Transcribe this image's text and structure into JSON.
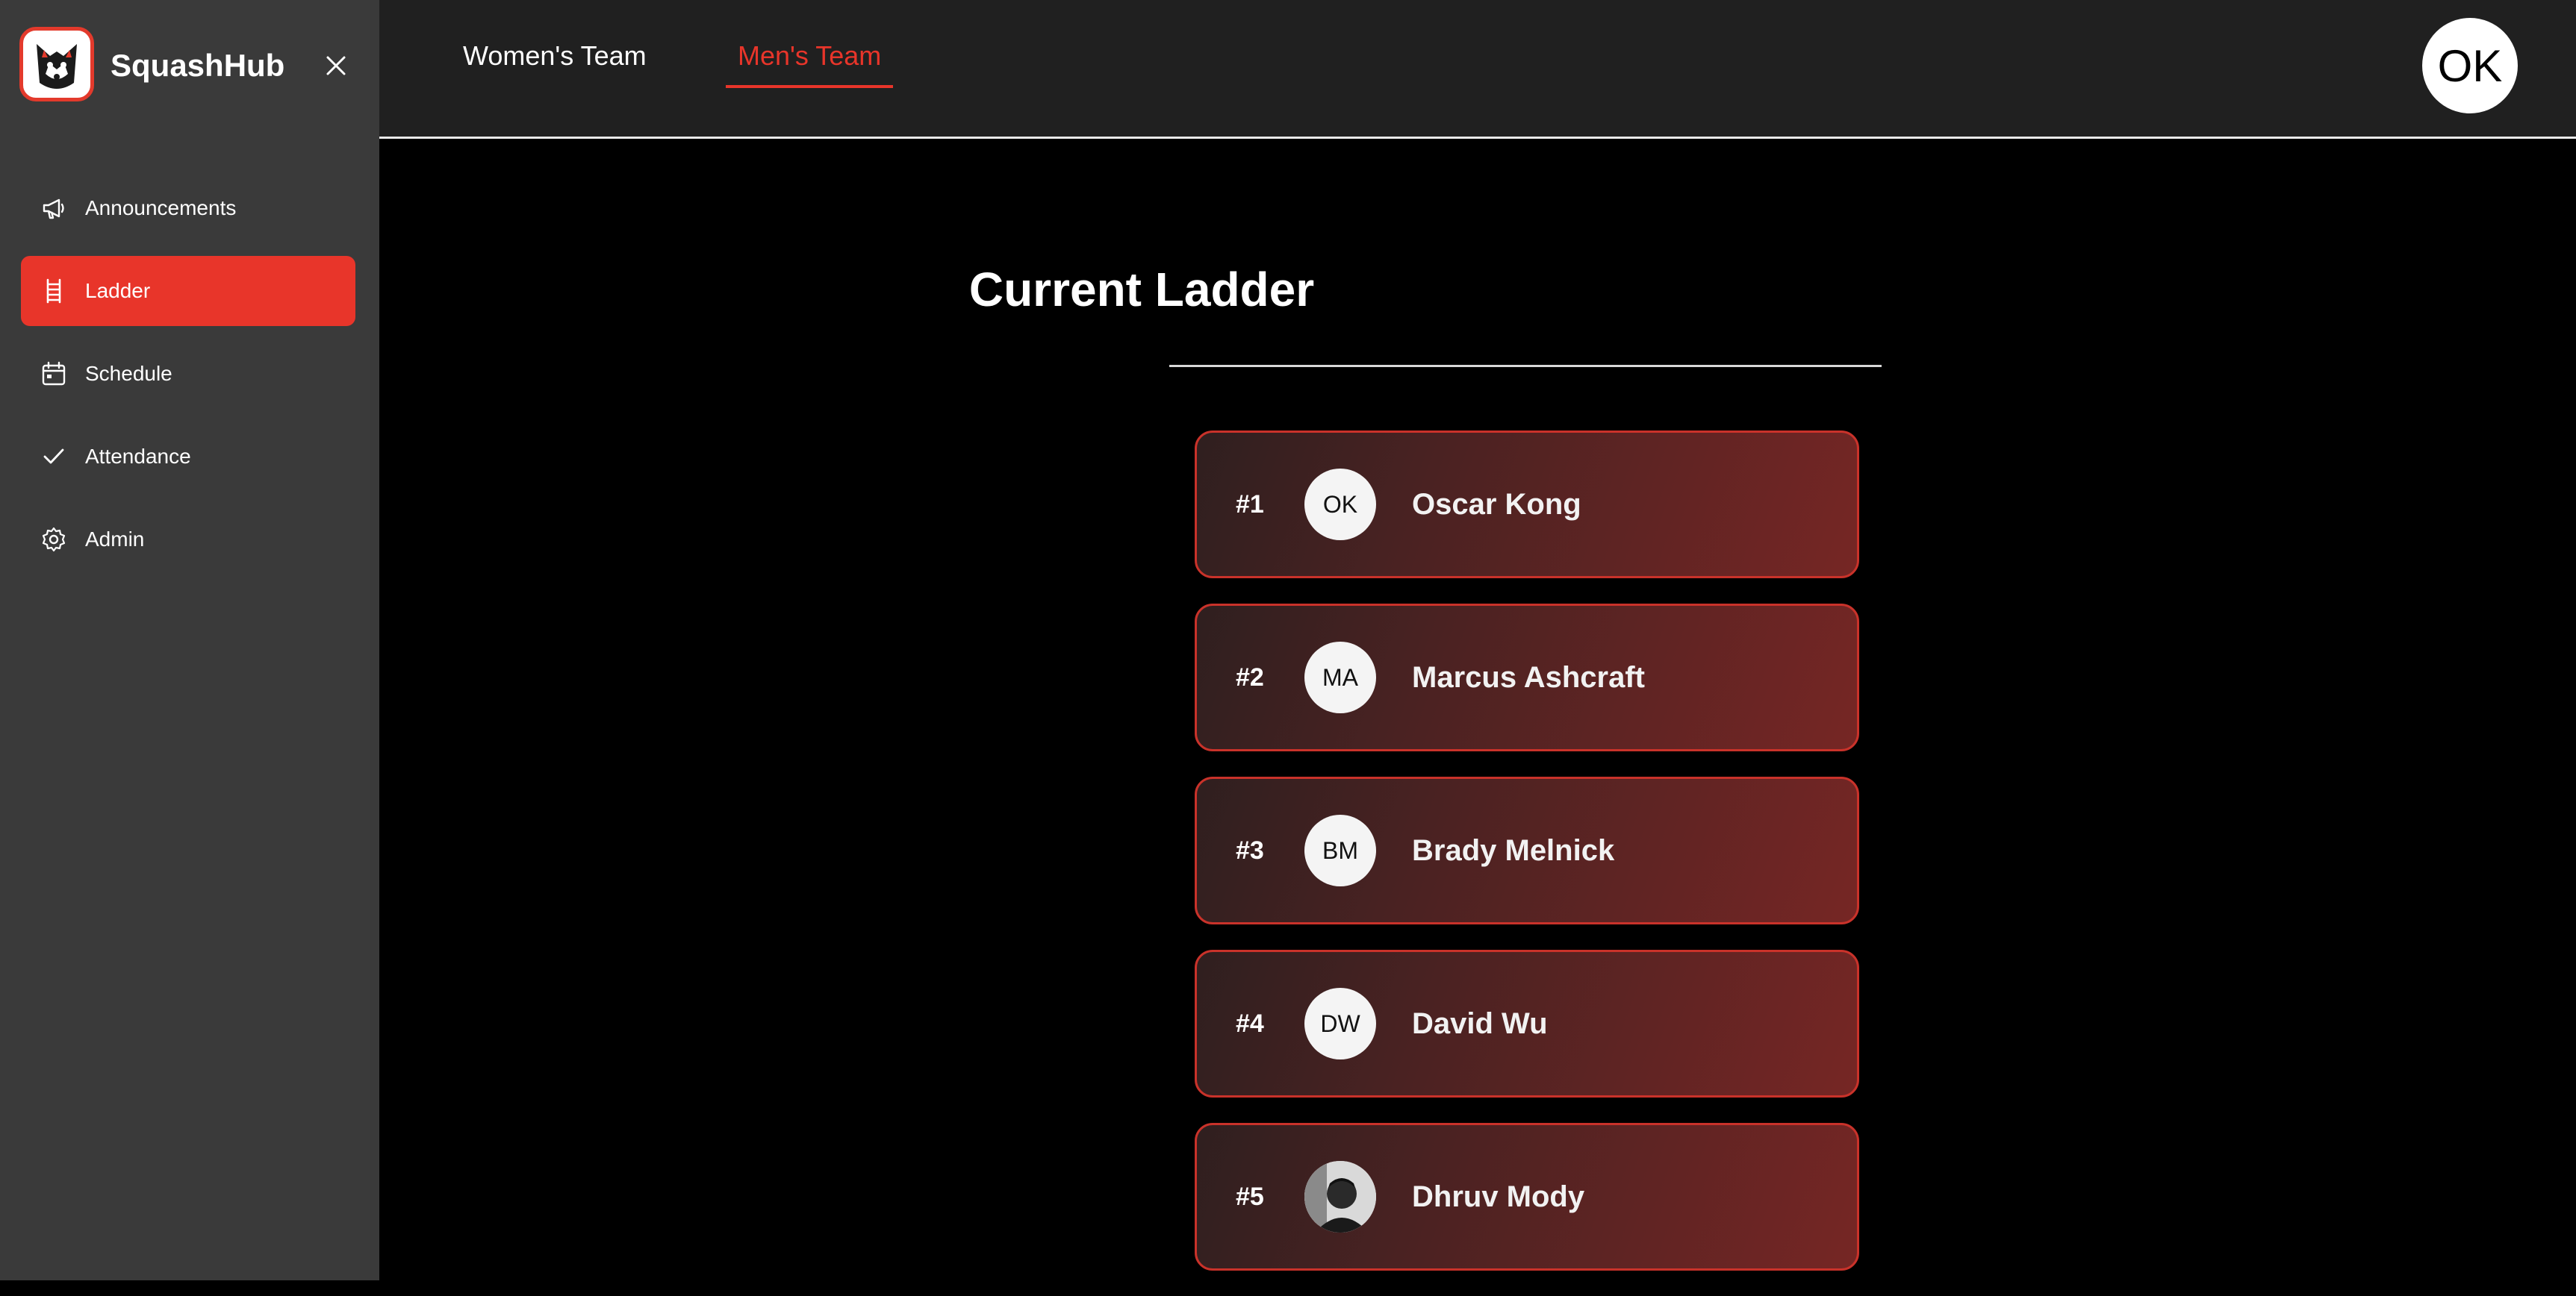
{
  "app": {
    "name": "SquashHub"
  },
  "sidebar": {
    "items": [
      {
        "label": "Announcements",
        "icon": "megaphone-icon",
        "active": false
      },
      {
        "label": "Ladder",
        "icon": "ladder-icon",
        "active": true
      },
      {
        "label": "Schedule",
        "icon": "calendar-icon",
        "active": false
      },
      {
        "label": "Attendance",
        "icon": "check-icon",
        "active": false
      },
      {
        "label": "Admin",
        "icon": "gear-icon",
        "active": false
      }
    ]
  },
  "header": {
    "tabs": [
      {
        "label": "Women's Team",
        "active": false
      },
      {
        "label": "Men's Team",
        "active": true
      }
    ],
    "user_initials": "OK"
  },
  "main": {
    "title": "Current Ladder",
    "ladder": [
      {
        "rank": "#1",
        "initials": "OK",
        "name": "Oscar Kong",
        "photo": false
      },
      {
        "rank": "#2",
        "initials": "MA",
        "name": "Marcus Ashcraft",
        "photo": false
      },
      {
        "rank": "#3",
        "initials": "BM",
        "name": "Brady Melnick",
        "photo": false
      },
      {
        "rank": "#4",
        "initials": "DW",
        "name": "David Wu",
        "photo": false
      },
      {
        "rank": "#5",
        "initials": "",
        "name": "Dhruv Mody",
        "photo": true
      }
    ]
  },
  "colors": {
    "accent": "#e8352a",
    "sidebar_bg": "#3a3a3a",
    "topbar_bg": "#202020",
    "main_bg": "#000000"
  }
}
